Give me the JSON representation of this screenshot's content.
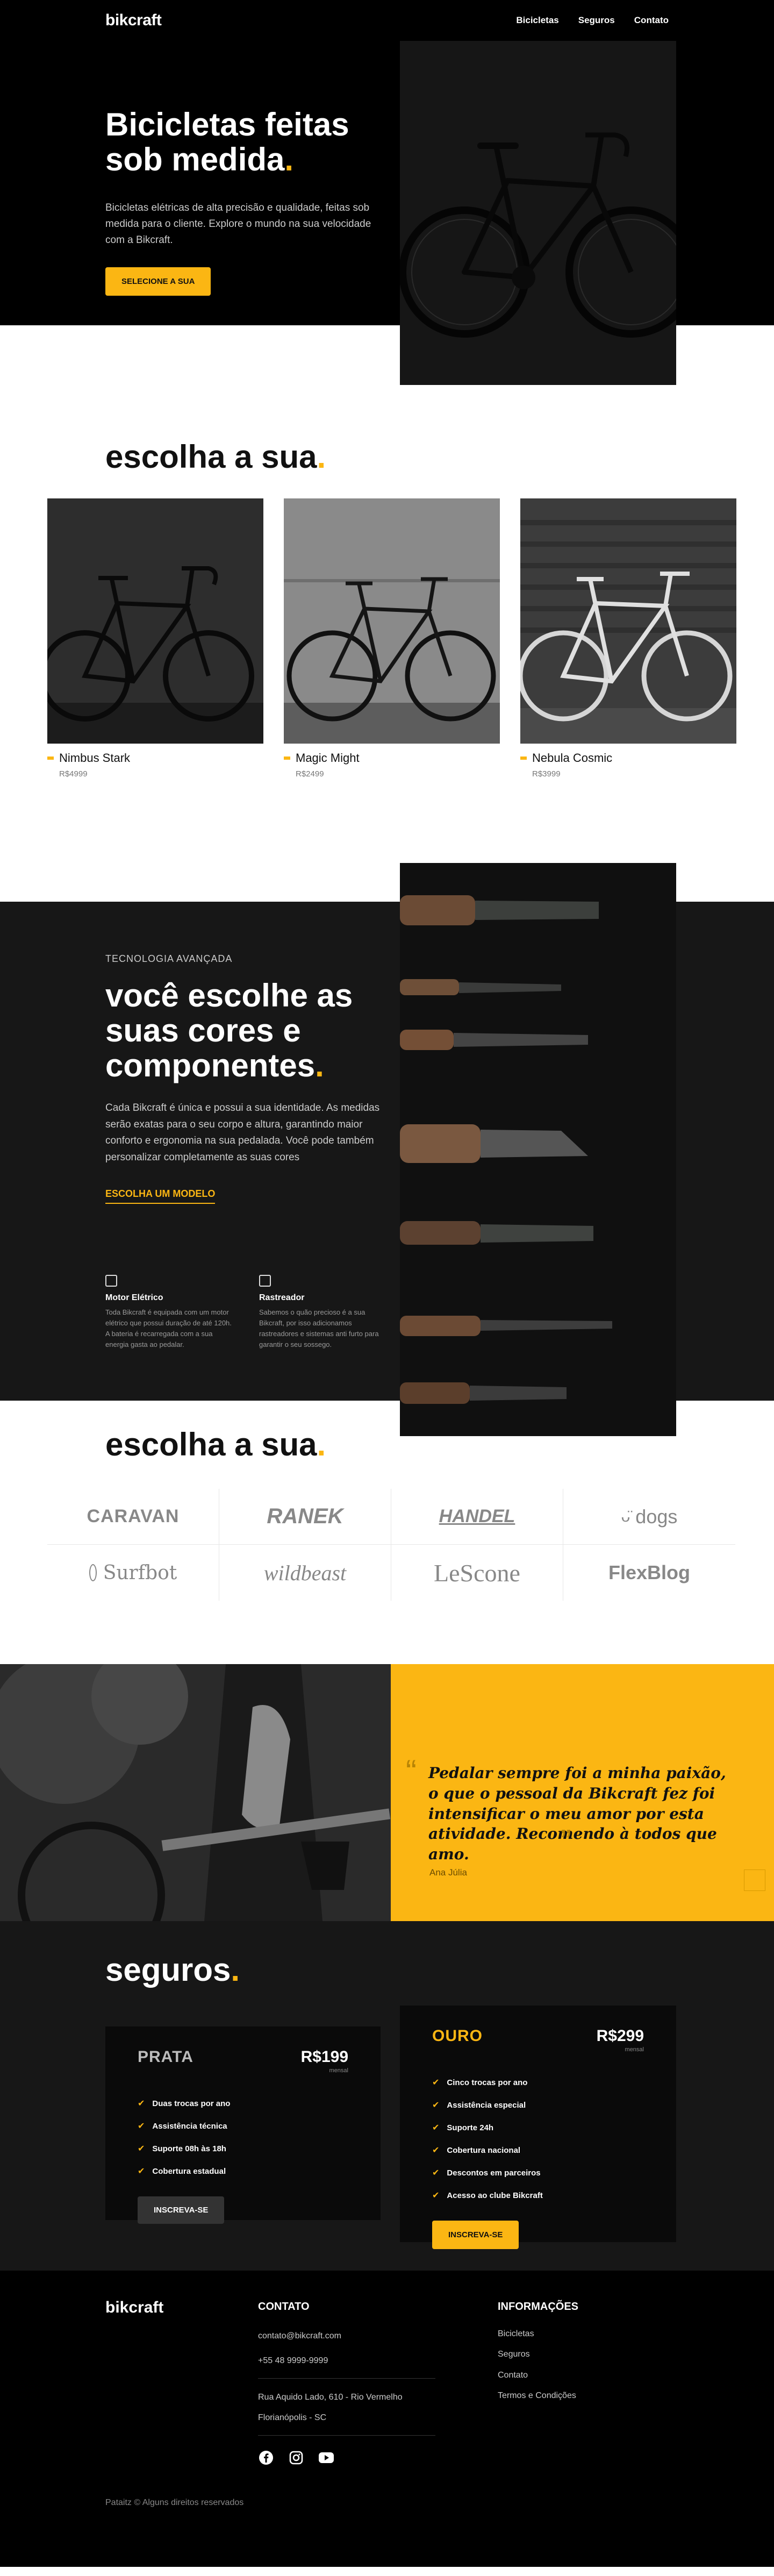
{
  "header": {
    "logo": "bikcraft",
    "nav": [
      "Bicicletas",
      "Seguros",
      "Contato"
    ]
  },
  "hero": {
    "title": "Bicicletas feitas sob medida",
    "description": "Bicicletas elétricas de alta precisão e qualidade, feitas sob medida para o cliente. Explore o mundo na sua velocidade com a Bikcraft.",
    "button": "Selecione a sua"
  },
  "models": {
    "title": "escolha a sua",
    "items": [
      {
        "name": "Nimbus Stark",
        "price": "R$4999"
      },
      {
        "name": "Magic Might",
        "price": "R$2499"
      },
      {
        "name": "Nebula Cosmic",
        "price": "R$3999"
      }
    ]
  },
  "tech": {
    "subtitle": "TECNOLOGIA AVANÇADA",
    "title": "você escolhe as suas cores e componentes",
    "description": "Cada Bikcraft é única e possui a sua identidade. As medidas serão exatas para o seu corpo e altura, garantindo maior conforto e ergonomia na sua pedalada. Você pode também personalizar completamente as suas cores",
    "link": "Escolha um modelo",
    "features": [
      {
        "title": "Motor Elétrico",
        "description": "Toda Bikcraft é equipada com um motor elétrico que possui duração de até 120h. A bateria é recarregada com a sua energia gasta ao pedalar."
      },
      {
        "title": "Rastreador",
        "description": "Sabemos o quão precioso é a sua Bikcraft, por isso adicionamos rastreadores e sistemas anti furto para garantir o seu sossego."
      }
    ]
  },
  "brands": {
    "title": "escolha a sua",
    "logos": [
      "CARAVAN",
      "RANEK",
      "HANDEL",
      "dogs",
      "Surfbot",
      "wildbeast",
      "LeScone",
      "FlexBlog"
    ]
  },
  "testimonial": {
    "quote": "Pedalar sempre foi a minha paixão, o que o pessoal da Bikcraft fez foi intensificar o meu amor por esta atividade. Recomendo à todos que amo.",
    "author": "Ana Júlia"
  },
  "insurance": {
    "title": "seguros",
    "plans": [
      {
        "name": "PRATA",
        "price": "R$199",
        "period": "mensal",
        "items": [
          "Duas trocas por ano",
          "Assistência técnica",
          "Suporte 08h às 18h",
          "Cobertura estadual"
        ],
        "button": "Inscreva-se"
      },
      {
        "name": "OURO",
        "price": "R$299",
        "period": "mensal",
        "items": [
          "Cinco trocas por ano",
          "Assistência especial",
          "Suporte 24h",
          "Cobertura nacional",
          "Descontos em parceiros",
          "Acesso ao clube Bikcraft"
        ],
        "button": "Inscreva-se"
      }
    ]
  },
  "footer": {
    "logo": "bikcraft",
    "contact_title": "Contato",
    "email": "contato@bikcraft.com",
    "phone": "+55 48 9999-9999",
    "address_line1": "Rua Aquido Lado, 610 - Rio Vermelho",
    "address_line2": "Florianópolis - SC",
    "info_title": "Informações",
    "links": [
      "Bicicletas",
      "Seguros",
      "Contato",
      "Termos e Condições"
    ],
    "socials": [
      "facebook-icon",
      "instagram-icon",
      "youtube-icon"
    ],
    "copyright": "Pataitz © Alguns direitos reservados"
  },
  "colors": {
    "accent": "#FBB613",
    "dark": "#171717",
    "black": "#000000"
  }
}
